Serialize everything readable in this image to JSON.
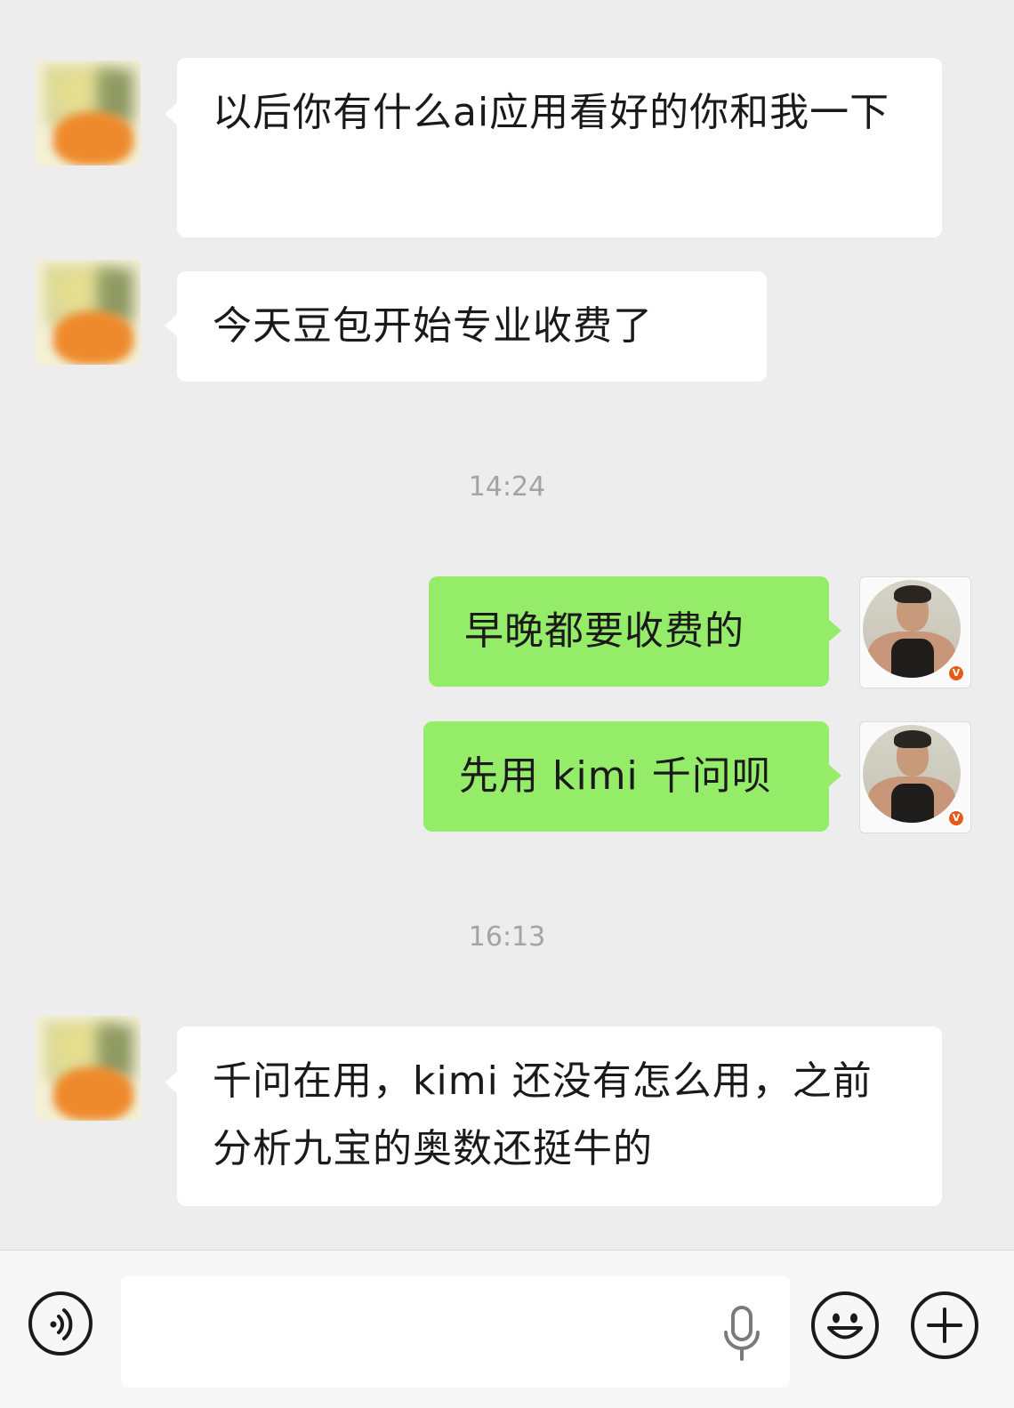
{
  "chat": {
    "messages": [
      {
        "side": "left",
        "text": "以后你有什么ai应用看好的你和我一下"
      },
      {
        "side": "left",
        "text": "今天豆包开始专业收费了"
      },
      {
        "side": "right",
        "text": "早晚都要收费的"
      },
      {
        "side": "right",
        "text": "先用 kimi 千问呗"
      },
      {
        "side": "left",
        "text": "千问在用，kimi 还没有怎么用，之前分析九宝的奥数还挺牛的"
      }
    ],
    "timestamps": [
      "14:24",
      "16:13"
    ],
    "badge_letter": "V"
  },
  "input_bar": {
    "placeholder": "",
    "value": "",
    "icons": [
      "voice-icon",
      "mic-icon",
      "emoji-icon",
      "plus-icon"
    ]
  },
  "colors": {
    "background": "#ededed",
    "bubble_left": "#ffffff",
    "bubble_right": "#95ec69",
    "timestamp": "#a3a3a3",
    "badge": "#e65b16"
  }
}
